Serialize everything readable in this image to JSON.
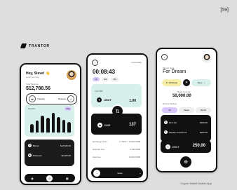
{
  "tag": "[59]",
  "brand": "TRANTOR",
  "credit": "Crypto Wallet Mobile App",
  "phone1": {
    "greeting": "Hey, Steve! 👋",
    "subtitle": "Good morning",
    "balance_label": "Total Balance",
    "balance": "$12,788.56",
    "transfer": "Transfer",
    "receive": "Receive",
    "chart_label": "Monthly",
    "chart_range": "May",
    "assets": [
      {
        "name": "Bitcoin",
        "amount": "$16,500.00"
      },
      {
        "name": "Ethereum",
        "amount": "$4,000.00"
      }
    ],
    "chart_data": {
      "type": "bar",
      "categories": [
        "1",
        "2",
        "3",
        "4",
        "5",
        "6",
        "7",
        "8"
      ],
      "values": [
        12,
        18,
        25,
        22,
        29,
        23,
        19,
        16
      ]
    }
  },
  "phone2": {
    "status": "Cold wallet",
    "time": "00:08:43",
    "period_tabs": [
      "1D",
      "1W",
      "1M"
    ],
    "top_label": "Your Bid",
    "pair": "USDT",
    "pair_value": "1.00",
    "dark_coin": "BNB",
    "dark_value": "137",
    "details": [
      {
        "label": "Exchange Rate",
        "value": "1 USDT = 0.0034 BNB"
      },
      {
        "label": "Network Fee",
        "value": "0.000 BNB"
      },
      {
        "label": "Gas Fee",
        "value": "0.0024 BNB"
      }
    ],
    "cta": "Swap"
  },
  "phone3": {
    "goal_label": "Money Goal",
    "title": "For Dream",
    "withdraw": "Withdraw",
    "save": "Save",
    "target_label": "Target Amount",
    "target": "50,000.00",
    "history_title": "Recent Saving",
    "tabs": [
      "All",
      "Week",
      "Month"
    ],
    "items": [
      {
        "name": "First Set",
        "date": "Sep 24",
        "value": "$400.00"
      },
      {
        "name": "Weekly Investment",
        "date": "Sep 18",
        "value": "$200.00"
      }
    ],
    "main_coin": "USDT",
    "main_amount": "250.00"
  }
}
